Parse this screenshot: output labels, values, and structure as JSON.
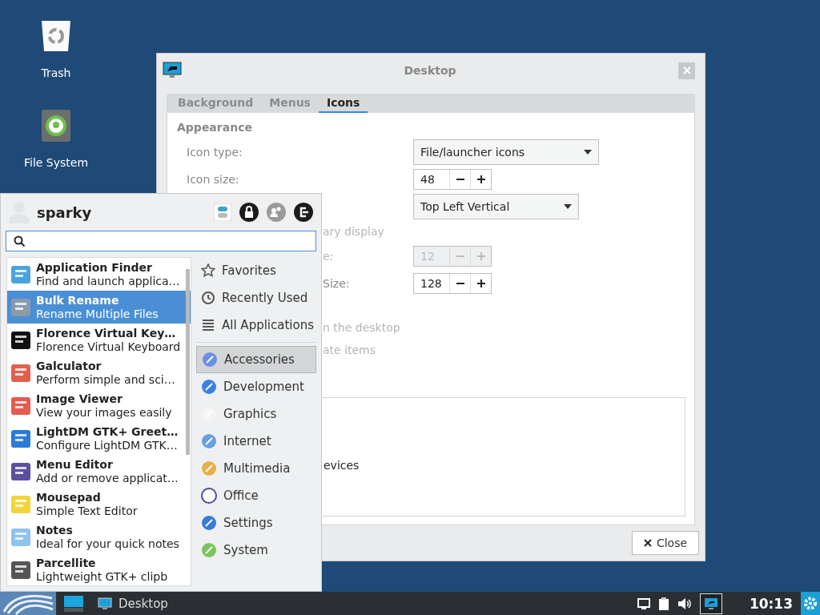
{
  "desktop_icons": [
    {
      "label": "Trash"
    },
    {
      "label": "File System"
    }
  ],
  "dialog": {
    "title": "Desktop",
    "tabs": [
      {
        "label": "Background",
        "selected": false
      },
      {
        "label": "Menus",
        "selected": false
      },
      {
        "label": "Icons",
        "selected": true
      }
    ],
    "section": "Appearance",
    "rows": [
      {
        "kind": "dropdown",
        "label": "Icon type:",
        "value": "File/launcher icons"
      },
      {
        "kind": "spin",
        "label": "Icon size:",
        "value": "48",
        "disabled": false
      },
      {
        "kind": "dropdown",
        "value": "Top Left Vertical"
      }
    ],
    "obscured_rows": [
      {
        "kind": "text",
        "label": "ary display",
        "disabled": true
      },
      {
        "kind": "spin",
        "label": "e:",
        "value": "12",
        "disabled": true
      },
      {
        "kind": "spin",
        "label": "Size:",
        "value": "128",
        "disabled": false
      },
      {
        "kind": "gap"
      },
      {
        "kind": "text",
        "label": "n the desktop",
        "disabled": true
      },
      {
        "kind": "text",
        "label": "ate items",
        "disabled": true
      }
    ],
    "list_items": [
      "evices"
    ],
    "close_button": "Close"
  },
  "menu": {
    "user": "sparky",
    "apps": [
      {
        "name": "Application Finder",
        "description": "Find and launch applica…",
        "selected": false
      },
      {
        "name": "Bulk Rename",
        "description": "Rename Multiple Files",
        "selected": true
      },
      {
        "name": "Florence Virtual Key…",
        "description": "Florence Virtual Keyboard",
        "selected": false
      },
      {
        "name": "Galculator",
        "description": "Perform simple and sci…",
        "selected": false
      },
      {
        "name": "Image Viewer",
        "description": "View your images easily",
        "selected": false
      },
      {
        "name": "LightDM GTK+ Greet…",
        "description": "Configure LightDM GTK…",
        "selected": false
      },
      {
        "name": "Menu Editor",
        "description": "Add or remove applicat…",
        "selected": false
      },
      {
        "name": "Mousepad",
        "description": "Simple Text Editor",
        "selected": false
      },
      {
        "name": "Notes",
        "description": "Ideal for your quick notes",
        "selected": false
      },
      {
        "name": "Parcellite",
        "description": "Lightweight GTK+ clipb",
        "selected": false
      }
    ],
    "places": [
      {
        "label": "Favorites"
      },
      {
        "label": "Recently Used"
      },
      {
        "label": "All Applications"
      }
    ],
    "categories": [
      {
        "label": "Accessories",
        "selected": true
      },
      {
        "label": "Development",
        "selected": false
      },
      {
        "label": "Graphics",
        "selected": false
      },
      {
        "label": "Internet",
        "selected": false
      },
      {
        "label": "Multimedia",
        "selected": false
      },
      {
        "label": "Office",
        "selected": false
      },
      {
        "label": "Settings",
        "selected": false
      },
      {
        "label": "System",
        "selected": false
      }
    ]
  },
  "taskbar": {
    "window_button": "Desktop",
    "clock": "10:13"
  }
}
